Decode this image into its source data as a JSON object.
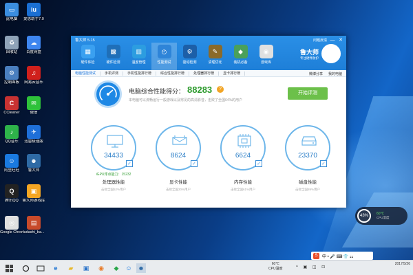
{
  "desktop_icons": [
    {
      "label": "此电脑",
      "color": "#3b8ee0",
      "glyph": "▭"
    },
    {
      "label": "爱思助手7.0",
      "color": "#1a6fd3",
      "glyph": "iu"
    },
    {
      "label": "回收站",
      "color": "#8fa3b8",
      "glyph": "♻"
    },
    {
      "label": "百度网盘",
      "color": "#3e86f0",
      "glyph": "☁"
    },
    {
      "label": "控制面板",
      "color": "#4a7fbf",
      "glyph": "⚙"
    },
    {
      "label": "网易云音乐",
      "color": "#d0201c",
      "glyph": "♫"
    },
    {
      "label": "CCleaner",
      "color": "#c83232",
      "glyph": "C"
    },
    {
      "label": "微信",
      "color": "#2ec23a",
      "glyph": "✉"
    },
    {
      "label": "QQ音乐",
      "color": "#2eb34a",
      "glyph": "♪"
    },
    {
      "label": "迅雷极速版",
      "color": "#1e6fd8",
      "glyph": "✈"
    },
    {
      "label": "阿里旺旺",
      "color": "#1a7ae0",
      "glyph": "☺"
    },
    {
      "label": "鲁大师",
      "color": "#2e6aa5",
      "glyph": "☻"
    },
    {
      "label": "腾讯QQ",
      "color": "#222222",
      "glyph": "Q"
    },
    {
      "label": "鲁大师游戏库",
      "color": "#f5a623",
      "glyph": "▣"
    },
    {
      "label": "Google Chrome",
      "color": "#e0e0e0",
      "glyph": "◎"
    },
    {
      "label": "ludashi_ba...",
      "color": "#c84a2a",
      "glyph": "▤"
    }
  ],
  "window": {
    "app_title": "鲁大师 5.15",
    "controls": {
      "feedback": "问题反馈",
      "min": "—",
      "close": "✕"
    },
    "nav": [
      {
        "label": "硬件体检",
        "glyph": "▦",
        "color": "#3aa0f0"
      },
      {
        "label": "硬件检测",
        "glyph": "▩",
        "color": "#1f6fb8"
      },
      {
        "label": "温度管理",
        "glyph": "▥",
        "color": "#2c9de0"
      },
      {
        "label": "性能测试",
        "glyph": "◴",
        "color": "#2e84d8"
      },
      {
        "label": "驱动检测",
        "glyph": "⚙",
        "color": "#1c5fa8"
      },
      {
        "label": "清理优化",
        "glyph": "✎",
        "color": "#8a6a2a"
      },
      {
        "label": "装机必备",
        "glyph": "◆",
        "color": "#4aa05a"
      },
      {
        "label": "游戏库",
        "glyph": "◉",
        "color": "#e0e0e0"
      }
    ],
    "brand": {
      "name": "鲁大师",
      "slogan": "专注硬件防护",
      "face": "☺"
    },
    "subtabs": [
      "电脑性能测试",
      "手机评测",
      "手机性能排行榜",
      "综合性能排行榜",
      "处理器排行榜",
      "显卡排行榜"
    ],
    "subtab_right": [
      "微博分享",
      "我的电脑"
    ],
    "score": {
      "label": "电脑综合性能得分：",
      "value": "88283",
      "help": "?",
      "sub": "本电脑可以流畅运行一般游戏以及常见的高清影音，击败了全国64%的用户",
      "start_button": "开始评测"
    },
    "categories": [
      {
        "name": "处理器性能",
        "value": "34433",
        "extra": "iGPU浮点能力：15232",
        "beat": "击败全国52%用户"
      },
      {
        "name": "显卡性能",
        "value": "8624",
        "extra": "",
        "beat": "击败全国30%用户"
      },
      {
        "name": "内存性能",
        "value": "6624",
        "extra": "",
        "beat": "击败全国61%用户"
      },
      {
        "name": "磁盘性能",
        "value": "23370",
        "extra": "",
        "beat": "击败全国89%用户"
      }
    ]
  },
  "temp_widget": {
    "percent": "43%",
    "deg": "60℃",
    "label": "CPU温度"
  },
  "ime": {
    "s": "S",
    "items": "中 • 🎤 ⌨ 👕 ⚏"
  },
  "taskbar": {
    "cpu_temp": "60℃",
    "cpu_label": "CPU温度",
    "tray_icons": "^ ▣ ◫ ⊡",
    "time": "",
    "date": "2017/5/26",
    "lang": "中"
  }
}
